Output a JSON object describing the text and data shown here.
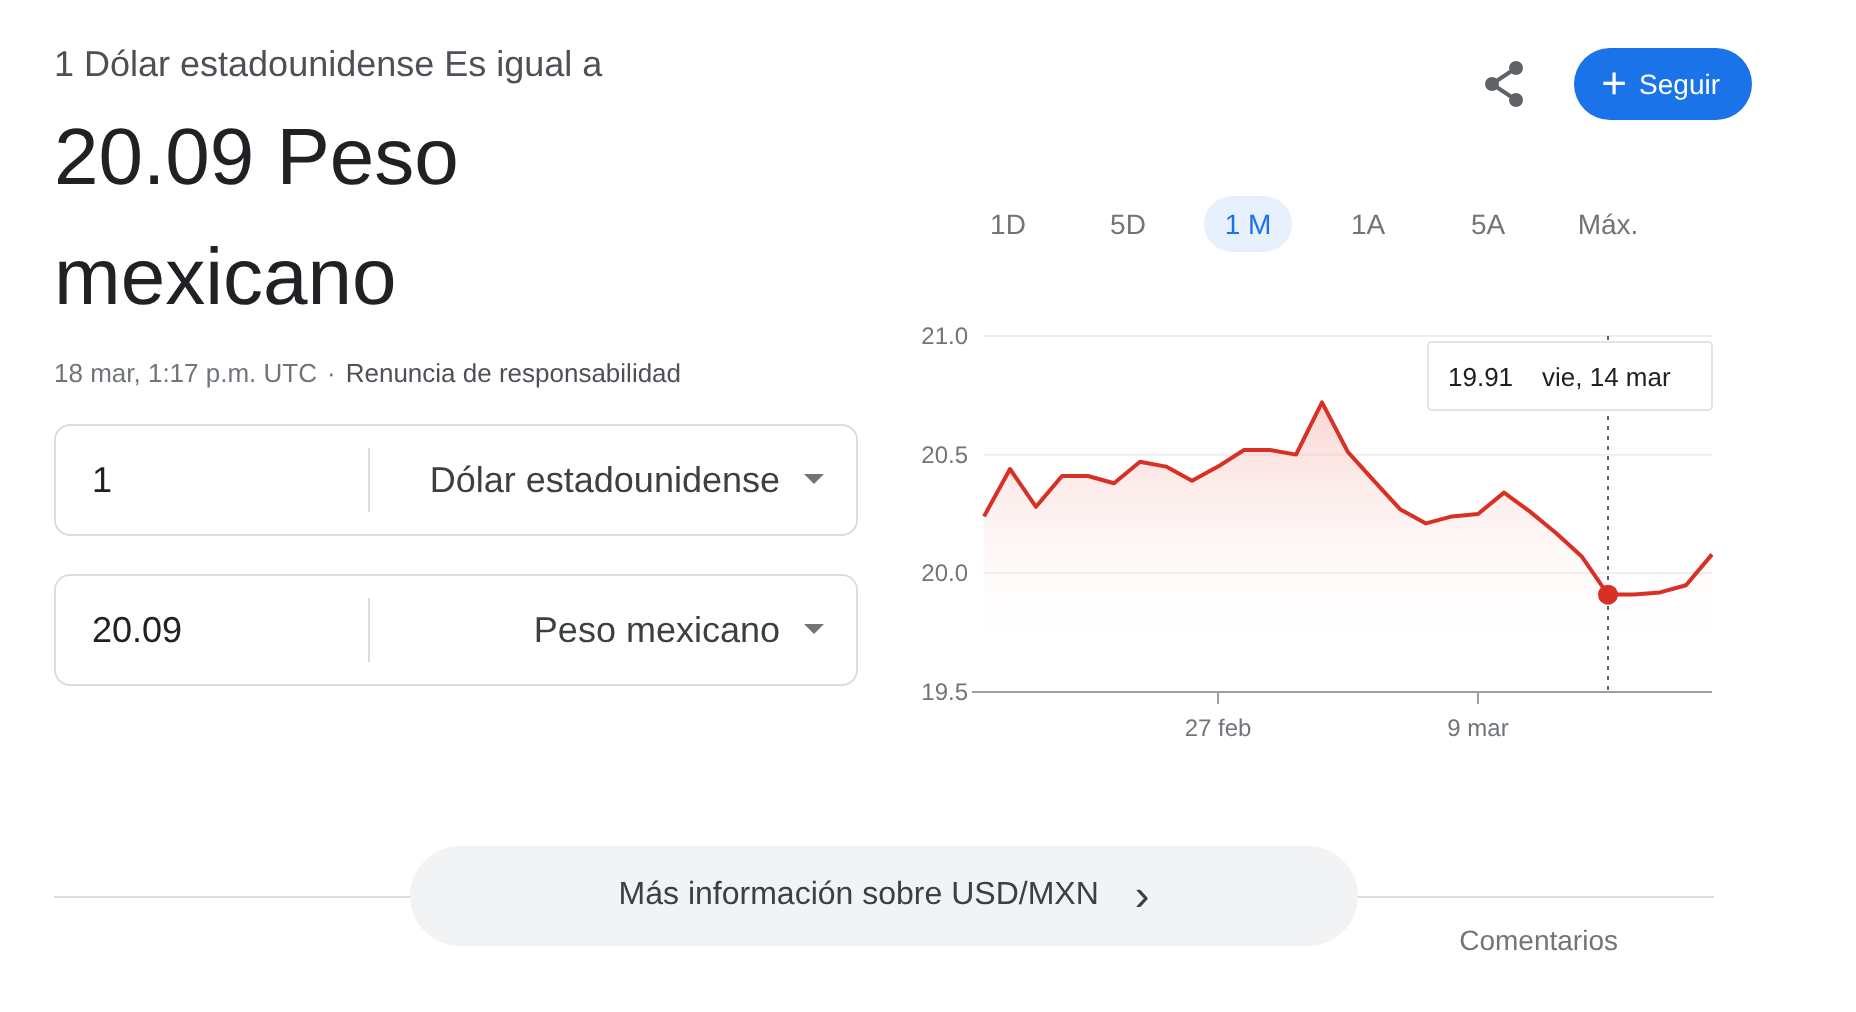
{
  "header": {
    "subtitle": "1 Dólar estadounidense Es igual a",
    "result": "20.09 Peso mexicano",
    "follow_button": {
      "icon": "+",
      "label": "Seguir"
    }
  },
  "meta": {
    "timestamp": "18 mar, 1:17 p.m. UTC",
    "separator": "·",
    "disclaimer_link": "Renuncia de responsabilidad"
  },
  "converter": [
    {
      "amount": "1",
      "currency": "Dólar estadounidense"
    },
    {
      "amount": "20.09",
      "currency": "Peso mexicano"
    }
  ],
  "ranges": [
    {
      "label": "1D",
      "selected": false
    },
    {
      "label": "5D",
      "selected": false
    },
    {
      "label": "1 M",
      "selected": true
    },
    {
      "label": "1A",
      "selected": false
    },
    {
      "label": "5A",
      "selected": false
    },
    {
      "label": "Máx.",
      "selected": false
    }
  ],
  "chart": {
    "chart_data": {
      "type": "area",
      "categories": [
        null,
        null,
        null,
        null,
        null,
        null,
        null,
        null,
        null,
        "27 feb",
        null,
        null,
        null,
        null,
        null,
        null,
        null,
        null,
        null,
        "9 mar",
        null,
        null,
        null,
        null,
        null,
        null,
        null,
        null,
        null
      ],
      "series": [
        {
          "color": "#d93025",
          "values": [
            20.24,
            20.44,
            20.28,
            20.41,
            20.41,
            20.38,
            20.47,
            20.45,
            20.39,
            20.45,
            20.52,
            20.52,
            20.5,
            20.72,
            20.51,
            20.39,
            20.27,
            20.21,
            20.24,
            20.25,
            20.34,
            20.26,
            20.17,
            20.07,
            19.91,
            19.91,
            19.92,
            19.95,
            20.08
          ]
        }
      ],
      "ylim": [
        19.5,
        21.0
      ],
      "yticks": [
        19.5,
        {
          "value": 20,
          "label": "20.0"
        },
        20.5,
        {
          "value": 21,
          "label": "21.0"
        }
      ]
    },
    "tooltip": {
      "value": "19.91",
      "date": "vie, 14 mar"
    }
  },
  "more_button": {
    "label": "Más información sobre USD/MXN",
    "icon": "›"
  },
  "feedback_link": "Comentarios"
}
